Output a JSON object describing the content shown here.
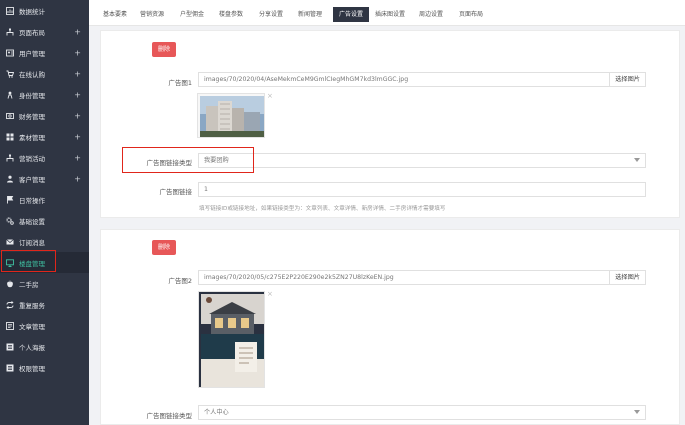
{
  "sidebar": {
    "items": [
      {
        "label": "数据统计",
        "icon": "chart-icon",
        "plus": false
      },
      {
        "label": "页面布局",
        "icon": "layout-icon",
        "plus": true
      },
      {
        "label": "用户管理",
        "icon": "user-icon",
        "plus": true
      },
      {
        "label": "在线认购",
        "icon": "cart-icon",
        "plus": true
      },
      {
        "label": "身份管理",
        "icon": "id-icon",
        "plus": true
      },
      {
        "label": "财务管理",
        "icon": "money-icon",
        "plus": true
      },
      {
        "label": "素材管理",
        "icon": "media-icon",
        "plus": true
      },
      {
        "label": "营销活动",
        "icon": "marketing-icon",
        "plus": true
      },
      {
        "label": "客户管理",
        "icon": "customer-icon",
        "plus": true
      },
      {
        "label": "日常操作",
        "icon": "flag-icon",
        "plus": false
      },
      {
        "label": "基础设置",
        "icon": "gear-icon",
        "plus": false
      },
      {
        "label": "订阅消息",
        "icon": "mail-icon",
        "plus": false
      },
      {
        "label": "楼盘管理",
        "icon": "monitor-icon",
        "plus": false,
        "active": true
      },
      {
        "label": "二手房",
        "icon": "apple-icon",
        "plus": false
      },
      {
        "label": "重复服务",
        "icon": "repeat-icon",
        "plus": false
      },
      {
        "label": "文章管理",
        "icon": "article-icon",
        "plus": false
      },
      {
        "label": "个人海报",
        "icon": "poster-icon",
        "plus": false
      },
      {
        "label": "权限管理",
        "icon": "permission-icon",
        "plus": false
      }
    ]
  },
  "tabs": [
    {
      "label": "基本要素"
    },
    {
      "label": "营销资源"
    },
    {
      "label": "户型佣金"
    },
    {
      "label": "楼盘参数"
    },
    {
      "label": "分享设置"
    },
    {
      "label": "新闻管理"
    },
    {
      "label": "广告设置",
      "active": true
    },
    {
      "label": "插床图设置"
    },
    {
      "label": "周边设置"
    },
    {
      "label": "页面布局"
    }
  ],
  "ad1": {
    "delete_label": "删除",
    "image_label": "广告图1",
    "image_path": "images/70/2020/04/AseMekmCeM9GmlCIegMhGM7kd3lmGGC.jpg",
    "choose_label": "选择图片",
    "link_type_label": "广告图链接类型",
    "link_type_value": "我要团购",
    "link_label": "广告图链接",
    "link_value": "1",
    "help_text": "填写链接ID或链接地址，如果链接类型为：文章列表、文章详情、新房详情、二手房详情才需要填写"
  },
  "ad2": {
    "delete_label": "删除",
    "image_label": "广告图2",
    "image_path": "images/70/2020/05/c275E2P220E290e2k5ZN27U8lzKeEN.jpg",
    "choose_label": "选择图片",
    "link_type_label": "广告图链接类型",
    "link_type_value": "个人中心"
  },
  "colors": {
    "sidebar_bg": "#2f3543",
    "active_text": "#3fbfa0",
    "delete_btn": "#e75758",
    "highlight": "#e0261b"
  }
}
